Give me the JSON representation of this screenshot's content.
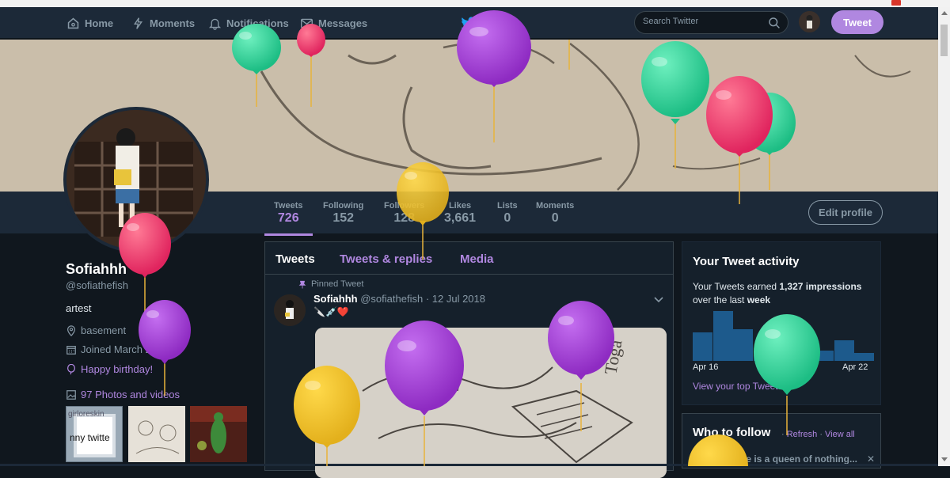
{
  "nav": {
    "home": "Home",
    "moments": "Moments",
    "notifications": "Notifications",
    "messages": "Messages",
    "search_placeholder": "Search Twitter",
    "tweet_button": "Tweet"
  },
  "stats": [
    {
      "label": "Tweets",
      "value": "726"
    },
    {
      "label": "Following",
      "value": "152"
    },
    {
      "label": "Followers",
      "value": "128"
    },
    {
      "label": "Likes",
      "value": "3,661"
    },
    {
      "label": "Lists",
      "value": "0"
    },
    {
      "label": "Moments",
      "value": "0"
    }
  ],
  "edit_profile": "Edit profile",
  "profile": {
    "name": "Sofiahhh",
    "handle": "@sofiathefish",
    "bio": "artest",
    "location": "basement",
    "joined": "Joined March 2018",
    "birthday": "Happy birthday!",
    "photos": "97 Photos and videos",
    "thumb1_text": "nny twitte",
    "thumb1_top": "girloreskin"
  },
  "timeline": {
    "tabs": [
      "Tweets",
      "Tweets & replies",
      "Media"
    ],
    "pinned": "Pinned Tweet",
    "author": "Sofiahhh",
    "author_handle": "@sofiathefish",
    "date": "· 12 Jul 2018",
    "emoji": "🔪💉❤️"
  },
  "activity": {
    "title": "Your Tweet activity",
    "text_prefix": "Your Tweets earned ",
    "impressions": "1,327 impressions",
    "text_mid": " over the last ",
    "period": "week",
    "bars": [
      0.55,
      0.95,
      0.6,
      0.2,
      0.2,
      0.2,
      0.2,
      0.4,
      0.15
    ],
    "axis_start": "Apr 16",
    "axis_end": "Apr 22",
    "link": "View your top Tweets"
  },
  "follow": {
    "title": "Who to follow",
    "refresh": "Refresh",
    "sep": " · ",
    "view_all": "View all",
    "suggestion": "She is a queen of nothing...",
    "dismiss": "✕"
  },
  "colors": {
    "accent": "#b087e0",
    "bg": "#10171e",
    "panel": "#1c2938"
  }
}
